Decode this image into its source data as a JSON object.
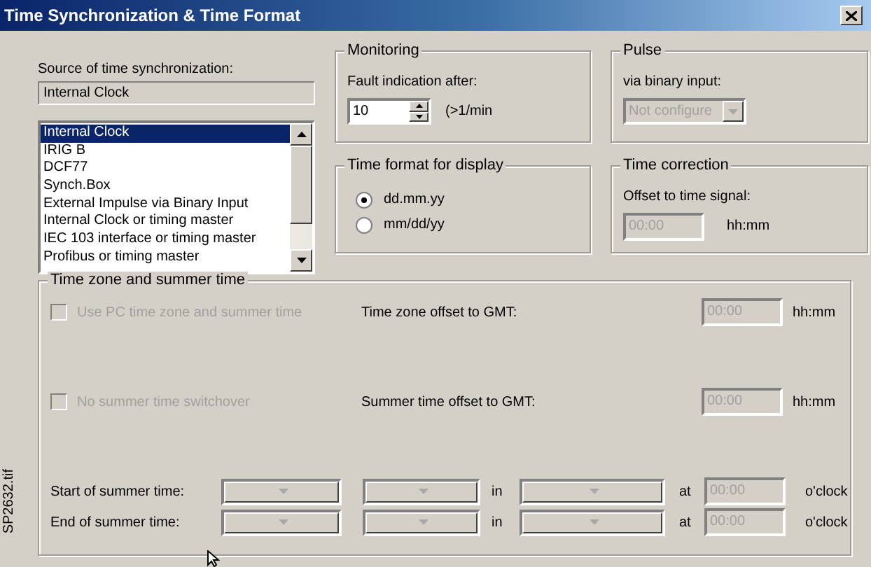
{
  "window": {
    "title": "Time Synchronization & Time Format"
  },
  "source": {
    "label": "Source of time synchronization:",
    "value": "Internal Clock",
    "options": [
      {
        "label": "Internal Clock",
        "selected": true
      },
      {
        "label": "IRIG B",
        "selected": false
      },
      {
        "label": "DCF77",
        "selected": false
      },
      {
        "label": "Synch.Box",
        "selected": false
      },
      {
        "label": "External Impulse via Binary Input",
        "selected": false
      },
      {
        "label": "Internal Clock or timing master",
        "selected": false
      },
      {
        "label": "IEC 103 interface or timing master",
        "selected": false
      },
      {
        "label": "Profibus or timing master",
        "selected": false
      }
    ]
  },
  "monitoring": {
    "title": "Monitoring",
    "label": "Fault indication after:",
    "value": "10",
    "unit": "(>1/min"
  },
  "pulse": {
    "title": "Pulse",
    "label": "via binary input:",
    "value": "Not configure",
    "disabled": true
  },
  "time_format": {
    "title": "Time format for display",
    "options": [
      {
        "label": "dd.mm.yy",
        "selected": true
      },
      {
        "label": "mm/dd/yy",
        "selected": false
      }
    ]
  },
  "time_correction": {
    "title": "Time correction",
    "label": "Offset to time signal:",
    "value": "00:00",
    "unit": "hh:mm",
    "disabled": true
  },
  "time_zone": {
    "title": "Time zone and summer time",
    "rows": [
      {
        "checkbox": "Use PC time zone and summer time",
        "checked": false,
        "disabled": true,
        "label": "Time zone offset to GMT:",
        "value": "00:00",
        "unit": "hh:mm"
      },
      {
        "checkbox": "No summer time switchover",
        "checked": false,
        "disabled": true,
        "label": "Summer time offset to GMT:",
        "value": "00:00",
        "unit": "hh:mm"
      }
    ],
    "summer": [
      {
        "label": "Start of summer time:",
        "in": "in",
        "at": "at",
        "value": "00:00",
        "unit": "o'clock"
      },
      {
        "label": "End of summer time:",
        "in": "in",
        "at": "at",
        "value": "00:00",
        "unit": "o'clock"
      }
    ]
  },
  "side_label": "SP2632.tif"
}
